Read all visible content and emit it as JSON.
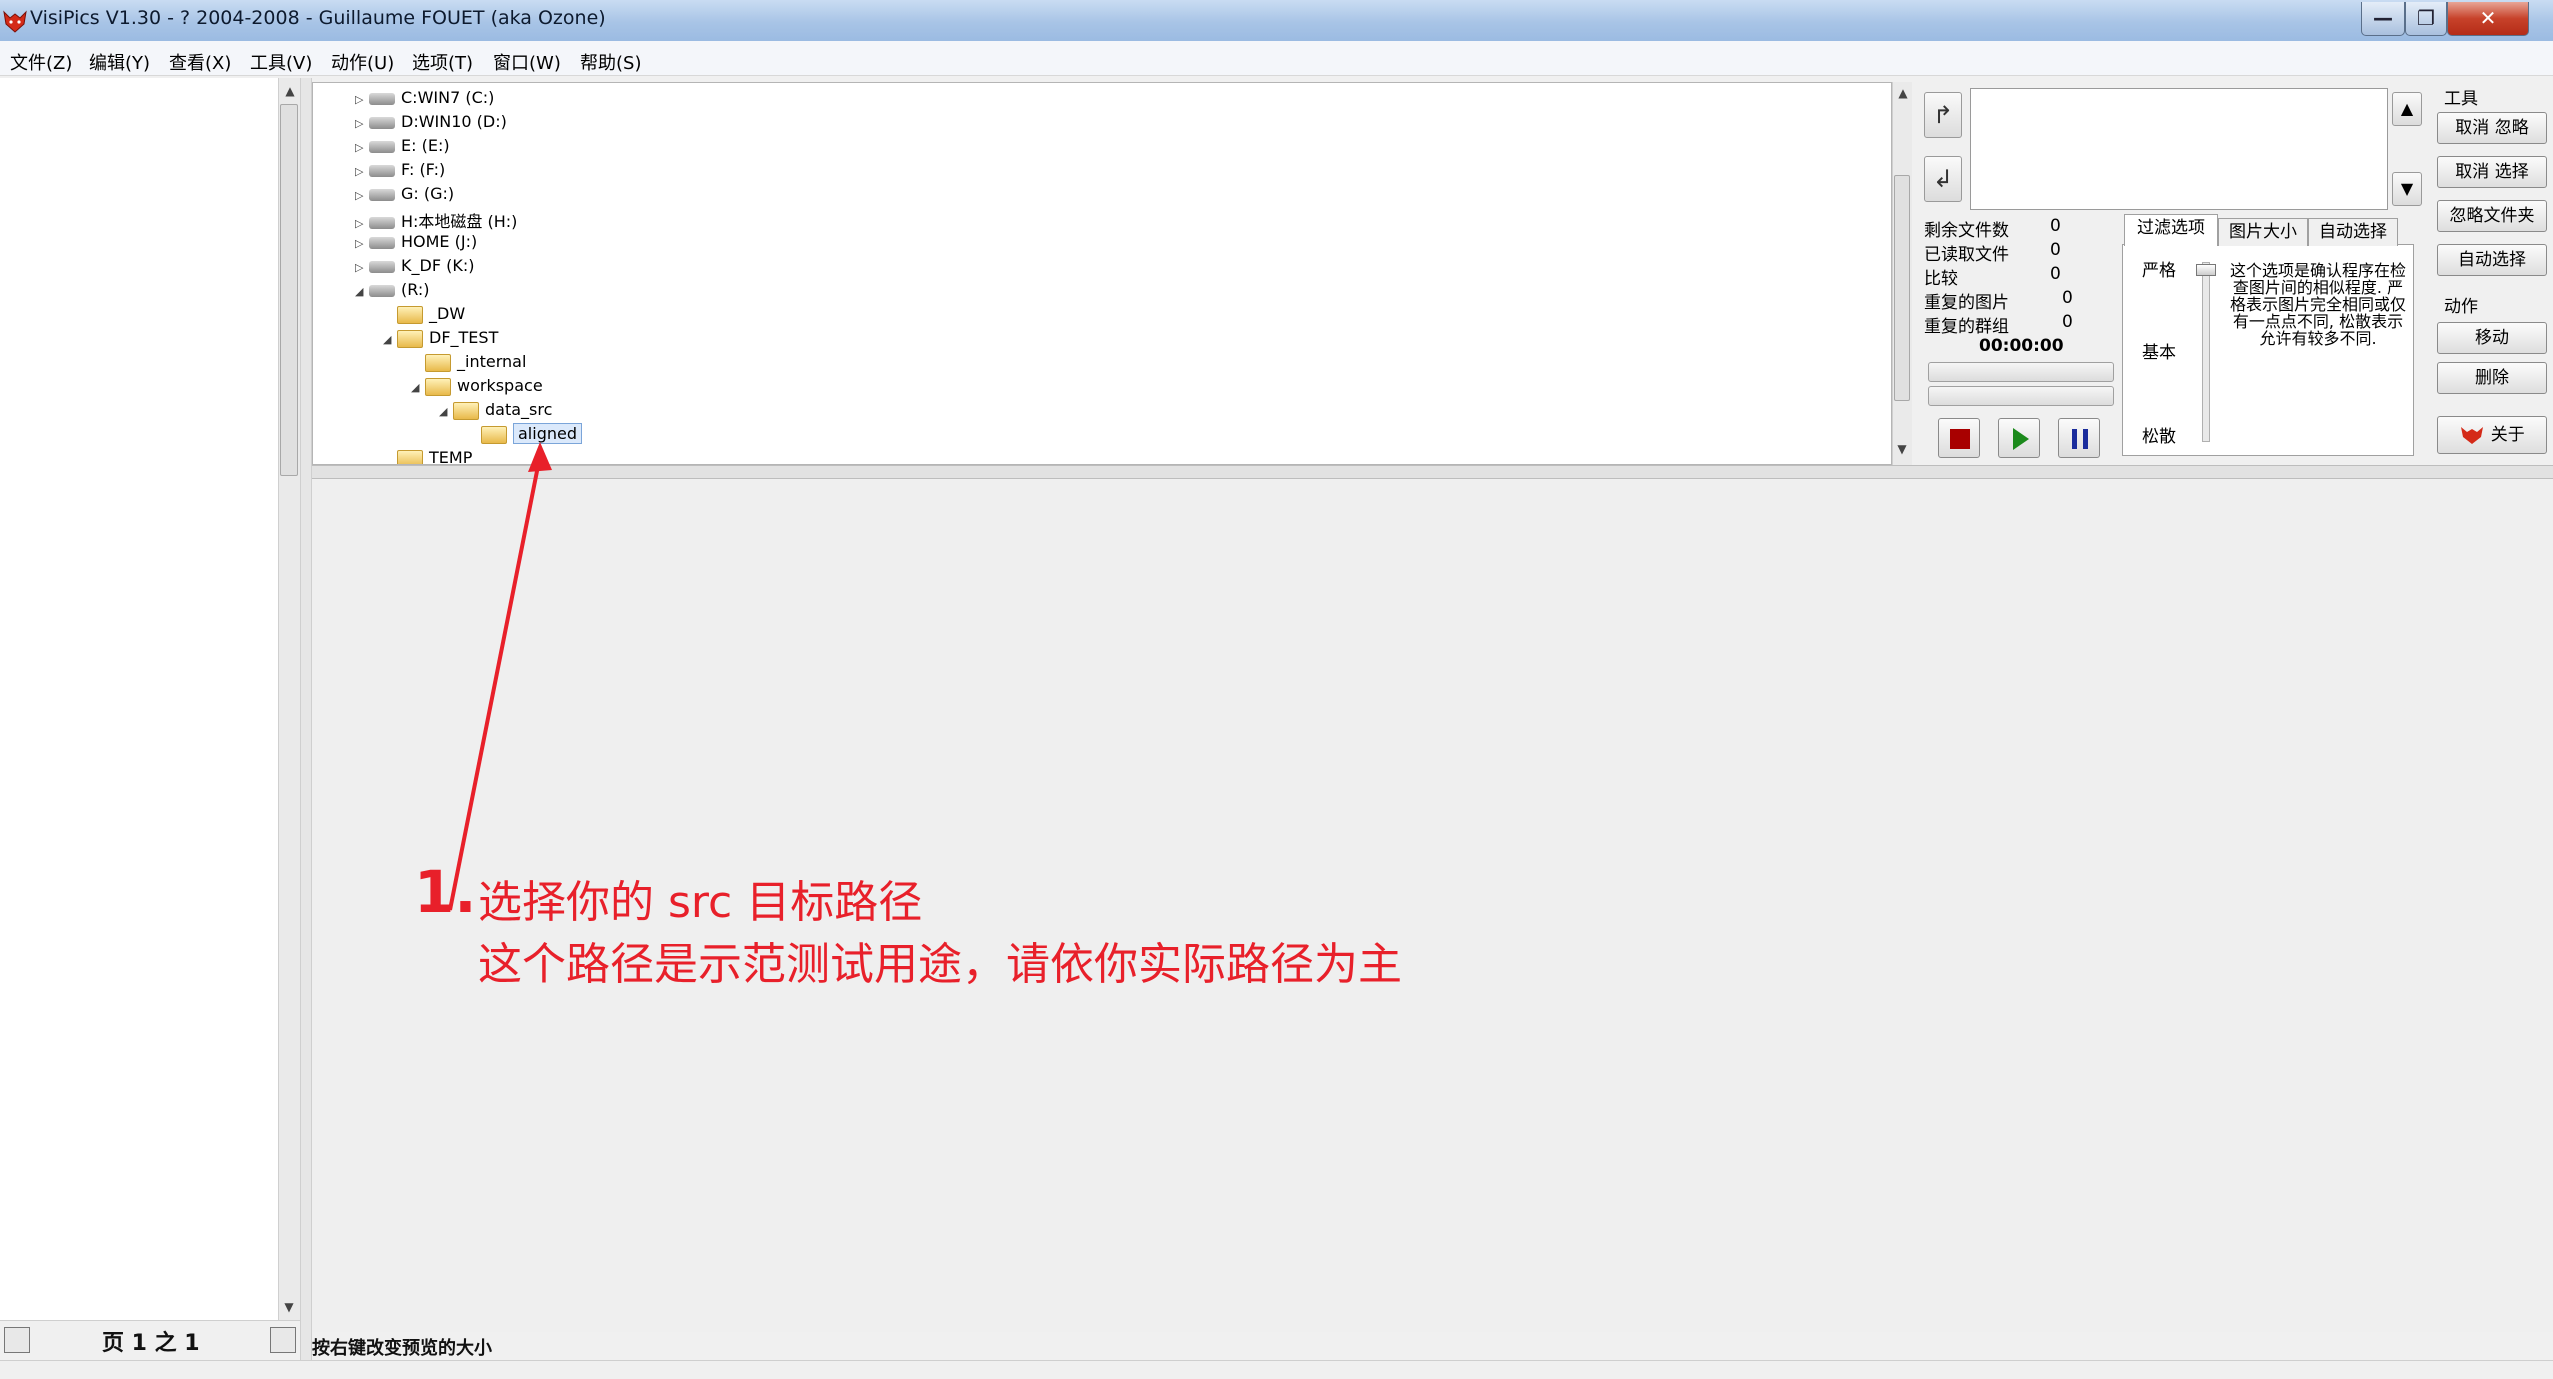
{
  "window": {
    "title": "VisiPics V1.30 - ? 2004-2008 - Guillaume FOUET (aka Ozone)",
    "minimize": "—",
    "maximize": "❐",
    "close": "✕"
  },
  "menu": [
    {
      "label": "文件(Z)"
    },
    {
      "label": "编辑(Y)"
    },
    {
      "label": "查看(X)"
    },
    {
      "label": "工具(V)"
    },
    {
      "label": "动作(U)"
    },
    {
      "label": "选项(T)"
    },
    {
      "label": "窗口(W)"
    },
    {
      "label": "帮助(S)"
    }
  ],
  "tree": [
    {
      "label": "C:WIN7 (C:)",
      "kind": "drive"
    },
    {
      "label": "D:WIN10 (D:)",
      "kind": "drive"
    },
    {
      "label": "E: (E:)",
      "kind": "drive"
    },
    {
      "label": "F: (F:)",
      "kind": "drive"
    },
    {
      "label": "G: (G:)",
      "kind": "drive"
    },
    {
      "label": "H:本地磁盘 (H:)",
      "kind": "drive"
    },
    {
      "label": "HOME (J:)",
      "kind": "network-drive"
    },
    {
      "label": "K_DF (K:)",
      "kind": "drive"
    },
    {
      "label": "(R:)",
      "kind": "drive"
    },
    {
      "label": "_DW",
      "kind": "folder"
    },
    {
      "label": "DF_TEST",
      "kind": "folder"
    },
    {
      "label": "_internal",
      "kind": "folder"
    },
    {
      "label": "workspace",
      "kind": "folder"
    },
    {
      "label": "data_src",
      "kind": "folder"
    },
    {
      "label": "aligned",
      "kind": "folder",
      "selected": true
    },
    {
      "label": "TEMP",
      "kind": "folder"
    }
  ],
  "stats": {
    "remaining_label": "剩余文件数",
    "remaining": "0",
    "read_label": "已读取文件",
    "read": "0",
    "compare_label": "比较",
    "compare": "0",
    "dup_pics_label": "重复的图片",
    "dup_pics": "0",
    "dup_groups_label": "重复的群组",
    "dup_groups": "0",
    "timer": "00:00:00"
  },
  "tabs": [
    {
      "label": "过滤选项"
    },
    {
      "label": "图片大小"
    },
    {
      "label": "自动选择"
    }
  ],
  "filter": {
    "strict": "严格",
    "basic": "基本",
    "loose": "松散",
    "description": "这个选项是确认程序在检查图片间的相似程度. 严格表示图片完全相同或仅有一点点不同, 松散表示允许有较多不同."
  },
  "tools": {
    "group_label": "工具",
    "cancel_ignore": "取消 忽略",
    "cancel_select": "取消 选择",
    "ignore_folder": "忽略文件夹",
    "auto_select": "自动选择",
    "action_label": "动作",
    "move": "移动",
    "delete": "删除",
    "about": "关于"
  },
  "left_panel": {
    "page_label": "页 1 之 1"
  },
  "preview": {
    "hint": "按右键改变预览的大小"
  },
  "annotation": {
    "number": "1.",
    "line1": "选择你的 src 目标路径",
    "line2": "这个路径是示范测试用途，请依你实际路径为主"
  },
  "colors": {
    "annotation": "#e8202a",
    "stop": "#a80000",
    "play": "#1c8a1c",
    "pause": "#1a2c9c"
  }
}
